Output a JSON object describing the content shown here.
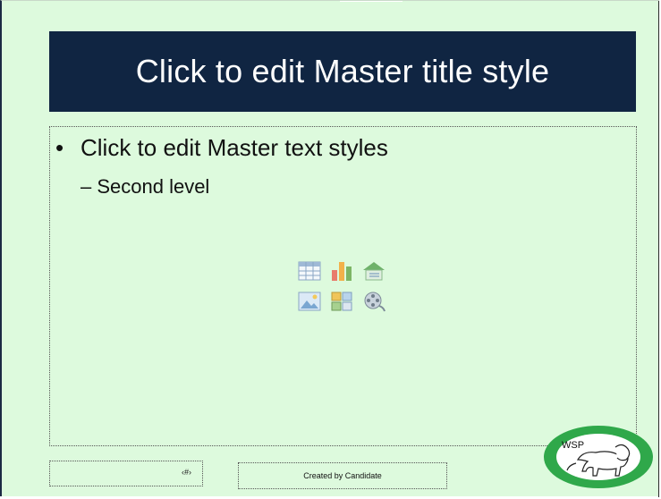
{
  "slide": {
    "title": "Click to edit Master title style",
    "body": {
      "level1_bullet": "•",
      "level1_text": "Click to edit Master text styles",
      "level2_text": "– Second level"
    },
    "content_icons": [
      "insert-table-icon",
      "insert-chart-icon",
      "insert-smartart-icon",
      "insert-picture-icon",
      "insert-clipart-icon",
      "insert-media-icon"
    ],
    "footer": {
      "page_number": "‹#›",
      "created_by": "Created by Candidate"
    },
    "logo": {
      "text": "WSP",
      "icon": "lion-logo-icon",
      "ring_color": "#2fa84a"
    },
    "colors": {
      "background": "#ddfadd",
      "title_fill": "#102542",
      "title_text": "#ffffff"
    }
  }
}
